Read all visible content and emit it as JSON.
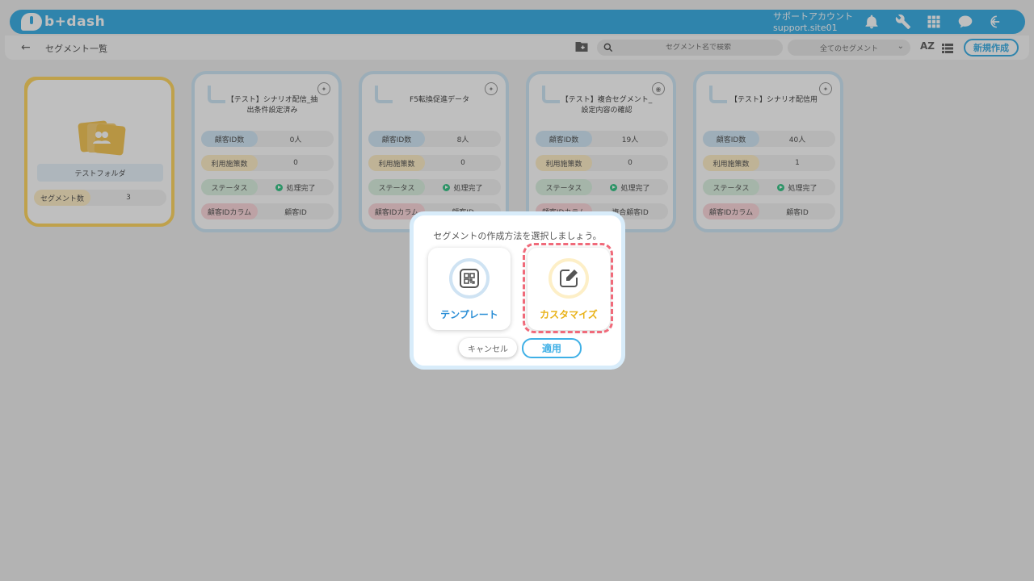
{
  "app": {
    "logo_text": "b+dash"
  },
  "header": {
    "account_label": "サポートアカウント",
    "account_id": "support.site01",
    "icons": [
      "bell-icon",
      "wrench-icon",
      "grid-icon",
      "chat-icon",
      "logout-icon"
    ]
  },
  "toolbar": {
    "back_icon": "←",
    "page_title": "セグメント一覧",
    "search_placeholder": "セグメント名で検索",
    "filter_value": "全てのセグメント",
    "sort_label": "AZ",
    "new_button": "新規作成"
  },
  "folder": {
    "name": "テストフォルダ",
    "count_label": "セグメント数",
    "count_value": "3"
  },
  "row_labels": {
    "ids": "顧客ID数",
    "usage": "利用施策数",
    "status": "ステータス",
    "column": "顧客IDカラム"
  },
  "segments": [
    {
      "name": "【テスト】シナリオ配信_抽出条件設定済み",
      "ids": "0人",
      "usage": "0",
      "status": "処理完了",
      "column": "顧客ID"
    },
    {
      "name": "F5転換促進データ",
      "ids": "8人",
      "usage": "0",
      "status": "処理完了",
      "column": "顧客ID"
    },
    {
      "name": "【テスト】複合セグメント_設定内容の確認",
      "ids": "19人",
      "usage": "0",
      "status": "処理完了",
      "column": "複合顧客ID"
    },
    {
      "name": "【テスト】シナリオ配信用",
      "ids": "40人",
      "usage": "1",
      "status": "処理完了",
      "column": "顧客ID"
    }
  ],
  "dialog": {
    "title": "セグメントの作成方法を選択しましょう。",
    "option_template": "テンプレート",
    "option_custom": "カスタマイズ",
    "cancel": "キャンセル",
    "apply": "適用"
  },
  "colors": {
    "brand": "#3fb0e6",
    "folder": "#ffd765",
    "highlight": "#f06a7a",
    "custom": "#e9b218",
    "template": "#2d8fd6"
  }
}
